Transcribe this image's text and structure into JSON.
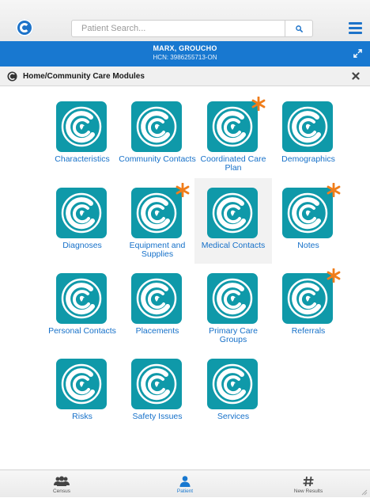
{
  "search": {
    "placeholder": "Patient Search..."
  },
  "patient": {
    "name": "MARX, GROUCHO",
    "hcn": "HCN: 3986255713-ON"
  },
  "section": {
    "title": "Home/Community Care Modules"
  },
  "modules": [
    {
      "label": "Characteristics",
      "flagged": false
    },
    {
      "label": "Community Contacts",
      "flagged": false
    },
    {
      "label": "Coordinated Care Plan",
      "flagged": true
    },
    {
      "label": "Demographics",
      "flagged": false
    },
    {
      "label": "Diagnoses",
      "flagged": false
    },
    {
      "label": "Equipment and Supplies",
      "flagged": true
    },
    {
      "label": "Medical Contacts",
      "flagged": false
    },
    {
      "label": "Notes",
      "flagged": true
    },
    {
      "label": "Personal Contacts",
      "flagged": false
    },
    {
      "label": "Placements",
      "flagged": false
    },
    {
      "label": "Primary Care Groups",
      "flagged": false
    },
    {
      "label": "Referrals",
      "flagged": true
    },
    {
      "label": "Risks",
      "flagged": false
    },
    {
      "label": "Safety Issues",
      "flagged": false
    },
    {
      "label": "Services",
      "flagged": false
    }
  ],
  "tabs": [
    {
      "label": "Census",
      "icon": "users-icon",
      "active": false
    },
    {
      "label": "Patient",
      "icon": "person-icon",
      "active": true
    },
    {
      "label": "New Results",
      "icon": "hash-icon",
      "active": false
    }
  ],
  "colors": {
    "accent": "#1878d0",
    "tile": "#0f99a9",
    "flag": "#f07d1a",
    "link": "#1570c9"
  }
}
